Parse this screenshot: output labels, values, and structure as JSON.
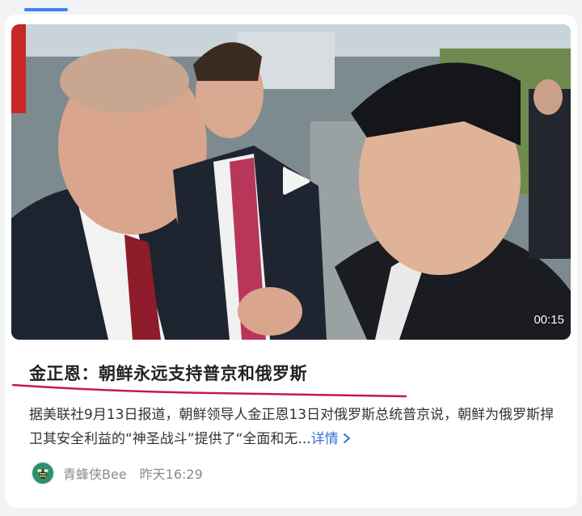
{
  "video": {
    "duration": "00:15",
    "play_icon": "play-icon"
  },
  "article": {
    "title": "金正恩：朝鲜永远支持普京和俄罗斯",
    "summary": "据美联社9月13日报道，朝鲜领导人金正恩13日对俄罗斯总统普京说，朝鲜为俄罗斯捍卫其安全利益的“神圣战斗”提供了“全面和无...",
    "more_label": "详情",
    "more_icon": "chevron-right-icon"
  },
  "meta": {
    "source": "青蜂侠Bee",
    "time": "昨天16:29",
    "avatar_icon": "bee-logo-icon"
  },
  "colors": {
    "accent": "#3b82f6",
    "link": "#3b6fd8",
    "underline": "#c2185b"
  }
}
